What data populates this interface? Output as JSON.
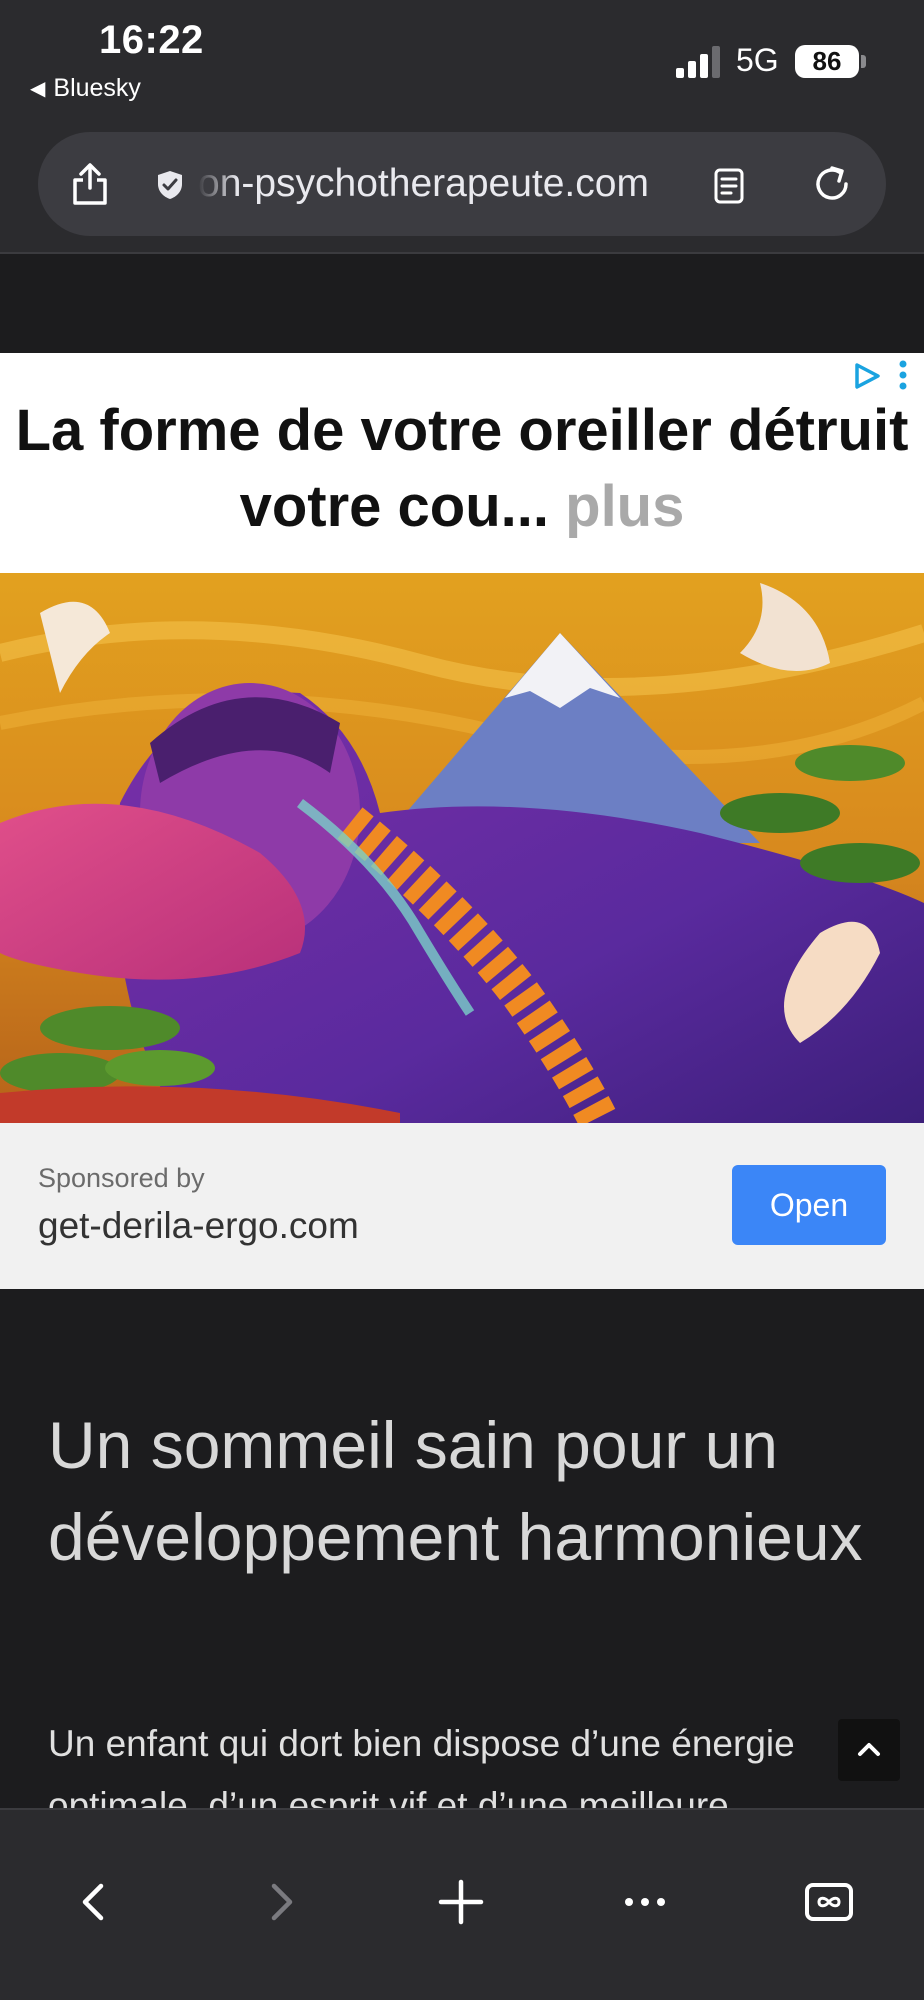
{
  "status_bar": {
    "time": "16:22",
    "back_app": "Bluesky",
    "network": "5G",
    "battery": "86"
  },
  "browser": {
    "url": "on-psychotherapeute.com"
  },
  "ad": {
    "headline_main": "La forme de votre oreiller détruit votre cou...",
    "headline_more": "plus",
    "sponsored_label": "Sponsored by",
    "sponsor_domain": "get-derila-ergo.com",
    "open_label": "Open"
  },
  "article": {
    "title": "Un sommeil sain pour un développement harmonieux",
    "body": "Un enfant qui dort bien dispose d’une énergie optimale, d’un esprit vif et d’une meilleure"
  },
  "colors": {
    "accent": "#3b86f7",
    "page_bg": "#1c1c1e",
    "chrome_bg": "#2b2b2e"
  },
  "icons": [
    "share-icon",
    "shield-icon",
    "reader-icon",
    "reload-icon",
    "back-arrow-icon",
    "forward-arrow-icon",
    "plus-icon",
    "more-icon",
    "tabs-icon",
    "ad-choices-icon",
    "chevron-up-icon"
  ]
}
